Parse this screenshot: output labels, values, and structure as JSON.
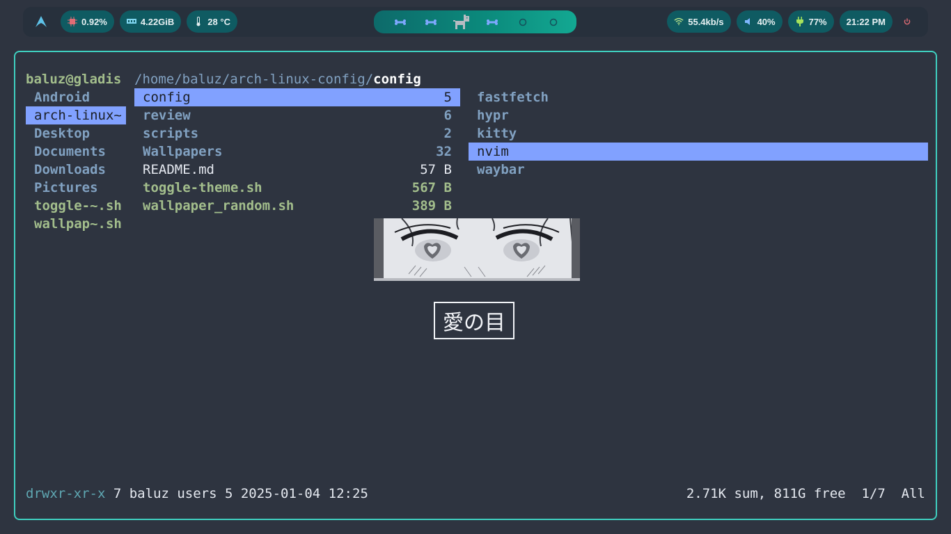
{
  "waybar": {
    "cpu": "0.92%",
    "memory": "4.22GiB",
    "temperature": "28 °C",
    "network": "55.4kb/s",
    "volume": "40%",
    "battery": "77%",
    "clock": "21:22 PM",
    "workspaces": [
      "bone-icon",
      "bone-icon",
      "dog-icon",
      "bone-icon",
      "circle-icon",
      "circle-icon"
    ],
    "accent": "#13a892"
  },
  "terminal": {
    "user_host": "baluz@gladis",
    "path_prefix": "/home/baluz/arch-linux-config/",
    "current_dir": "config",
    "parent_entries": [
      "Android",
      "arch-linux~",
      "Desktop",
      "Documents",
      "Downloads",
      "Pictures",
      "toggle-~.sh",
      "wallpap~.sh"
    ],
    "current_entries": [
      {
        "name": "config",
        "size": "5"
      },
      {
        "name": "review",
        "size": "6"
      },
      {
        "name": "scripts",
        "size": "2"
      },
      {
        "name": "Wallpapers",
        "size": "32"
      },
      {
        "name": "README.md",
        "size": "57 B"
      },
      {
        "name": "toggle-theme.sh",
        "size": "567 B"
      },
      {
        "name": "wallpaper_random.sh",
        "size": "389 B"
      }
    ],
    "preview_entries": [
      "fastfetch",
      "hypr",
      "kitty",
      "nvim",
      "waybar"
    ],
    "preview_caption": "愛の目",
    "status_perms": "drwxr-xr-x",
    "status_info": " 7 baluz users 5 2025-01-04 12:25",
    "status_right": "2.71K sum, 811G free  1/7  All"
  }
}
